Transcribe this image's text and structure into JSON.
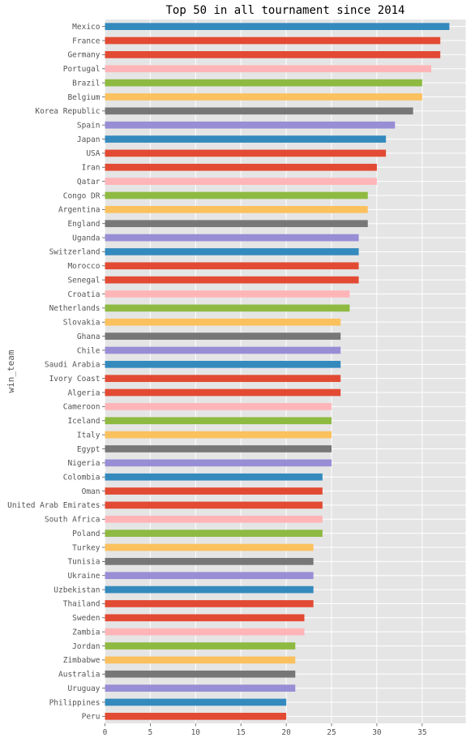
{
  "chart_data": {
    "type": "bar",
    "orientation": "horizontal",
    "title": "Top 50 in all tournament since 2014",
    "xlabel": "",
    "ylabel": "win_team",
    "xlim": [
      0,
      39.8
    ],
    "xticks": [
      0,
      5,
      10,
      15,
      20,
      25,
      30,
      35
    ],
    "grid": true,
    "legend": "none",
    "background": "#E5E5E5",
    "categories": [
      "Mexico",
      "France",
      "Germany",
      "Portugal",
      "Brazil",
      "Belgium",
      "Korea Republic",
      "Spain",
      "Japan",
      "USA",
      "Iran",
      "Qatar",
      "Congo DR",
      "Argentina",
      "England",
      "Uganda",
      "Switzerland",
      "Morocco",
      "Senegal",
      "Croatia",
      "Netherlands",
      "Slovakia",
      "Ghana",
      "Chile",
      "Saudi Arabia",
      "Ivory Coast",
      "Algeria",
      "Cameroon",
      "Iceland",
      "Italy",
      "Egypt",
      "Nigeria",
      "Colombia",
      "Oman",
      "United Arab Emirates",
      "South Africa",
      "Poland",
      "Turkey",
      "Tunisia",
      "Ukraine",
      "Uzbekistan",
      "Thailand",
      "Sweden",
      "Zambia",
      "Jordan",
      "Zimbabwe",
      "Australia",
      "Uruguay",
      "Philippines",
      "Peru"
    ],
    "values": [
      38,
      37,
      37,
      36,
      35,
      35,
      34,
      32,
      31,
      31,
      30,
      30,
      29,
      29,
      29,
      28,
      28,
      28,
      28,
      27,
      27,
      26,
      26,
      26,
      26,
      26,
      26,
      25,
      25,
      25,
      25,
      25,
      24,
      24,
      24,
      24,
      24,
      23,
      23,
      23,
      23,
      23,
      22,
      22,
      21,
      21,
      21,
      21,
      20,
      20
    ],
    "color_cycle_from_bottom": [
      "#E24A33",
      "#348ABD",
      "#988ED5",
      "#777777",
      "#FBC15E",
      "#8EBA42",
      "#FFB5B8",
      "#E24A33"
    ]
  }
}
